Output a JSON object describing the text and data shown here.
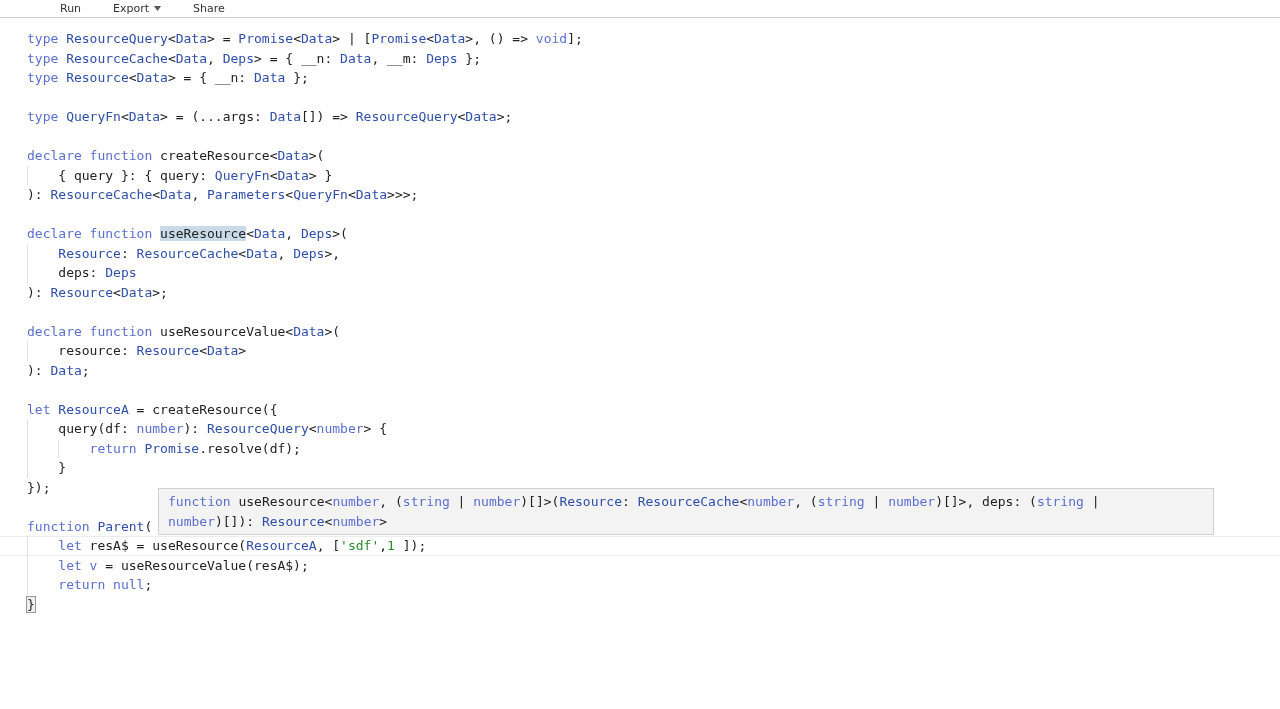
{
  "menu": [
    {
      "label": "Run",
      "dropdown": false
    },
    {
      "label": "Export",
      "dropdown": true
    },
    {
      "label": "Share",
      "dropdown": false
    }
  ],
  "editor": {
    "lines": [
      {
        "current": false,
        "tokens": [
          {
            "kind": "k",
            "text": "type"
          },
          {
            "kind": "t",
            "text": " ResourceQuery"
          },
          {
            "kind": "p",
            "text": "<"
          },
          {
            "kind": "t",
            "text": "Data"
          },
          {
            "kind": "p",
            "text": "> = "
          },
          {
            "kind": "t",
            "text": "Promise"
          },
          {
            "kind": "p",
            "text": "<"
          },
          {
            "kind": "t",
            "text": "Data"
          },
          {
            "kind": "p",
            "text": "> | ["
          },
          {
            "kind": "t",
            "text": "Promise"
          },
          {
            "kind": "p",
            "text": "<"
          },
          {
            "kind": "t",
            "text": "Data"
          },
          {
            "kind": "p",
            "text": ">, () => "
          },
          {
            "kind": "k",
            "text": "void"
          },
          {
            "kind": "p",
            "text": "];"
          }
        ]
      },
      {
        "current": false,
        "tokens": [
          {
            "kind": "k",
            "text": "type"
          },
          {
            "kind": "t",
            "text": " ResourceCache"
          },
          {
            "kind": "p",
            "text": "<"
          },
          {
            "kind": "t",
            "text": "Data"
          },
          {
            "kind": "p",
            "text": ", "
          },
          {
            "kind": "t",
            "text": "Deps"
          },
          {
            "kind": "p",
            "text": "> = { __n: "
          },
          {
            "kind": "t",
            "text": "Data"
          },
          {
            "kind": "p",
            "text": ", __m: "
          },
          {
            "kind": "t",
            "text": "Deps"
          },
          {
            "kind": "p",
            "text": " };"
          }
        ]
      },
      {
        "current": false,
        "tokens": [
          {
            "kind": "k",
            "text": "type"
          },
          {
            "kind": "t",
            "text": " Resource"
          },
          {
            "kind": "p",
            "text": "<"
          },
          {
            "kind": "t",
            "text": "Data"
          },
          {
            "kind": "p",
            "text": "> = { __n: "
          },
          {
            "kind": "t",
            "text": "Data"
          },
          {
            "kind": "p",
            "text": " };"
          }
        ]
      },
      {
        "current": false
      },
      {
        "current": false,
        "tokens": [
          {
            "kind": "k",
            "text": "type"
          },
          {
            "kind": "t",
            "text": " QueryFn"
          },
          {
            "kind": "p",
            "text": "<"
          },
          {
            "kind": "t",
            "text": "Data"
          },
          {
            "kind": "p",
            "text": "> = (...args: "
          },
          {
            "kind": "t",
            "text": "Data"
          },
          {
            "kind": "p",
            "text": "[]) => "
          },
          {
            "kind": "t",
            "text": "ResourceQuery"
          },
          {
            "kind": "p",
            "text": "<"
          },
          {
            "kind": "t",
            "text": "Data"
          },
          {
            "kind": "p",
            "text": ">;"
          }
        ]
      },
      {
        "current": false
      },
      {
        "current": false,
        "tokens": [
          {
            "kind": "k",
            "text": "declare function"
          },
          {
            "kind": "p",
            "text": " createResource<"
          },
          {
            "kind": "t",
            "text": "Data"
          },
          {
            "kind": "p",
            "text": ">("
          }
        ]
      },
      {
        "current": false,
        "tokens": [
          {
            "kind": "p",
            "text": "    { query }: { query: "
          },
          {
            "kind": "t",
            "text": "QueryFn"
          },
          {
            "kind": "p",
            "text": "<"
          },
          {
            "kind": "t",
            "text": "Data"
          },
          {
            "kind": "p",
            "text": "> }"
          }
        ]
      },
      {
        "current": false,
        "tokens": [
          {
            "kind": "p",
            "text": "): "
          },
          {
            "kind": "t",
            "text": "ResourceCache"
          },
          {
            "kind": "p",
            "text": "<"
          },
          {
            "kind": "t",
            "text": "Data"
          },
          {
            "kind": "p",
            "text": ", "
          },
          {
            "kind": "t",
            "text": "Parameters"
          },
          {
            "kind": "p",
            "text": "<"
          },
          {
            "kind": "t",
            "text": "QueryFn"
          },
          {
            "kind": "p",
            "text": "<"
          },
          {
            "kind": "t",
            "text": "Data"
          },
          {
            "kind": "p",
            "text": ">>>;"
          }
        ]
      },
      {
        "current": false
      },
      {
        "current": false,
        "tokens": [
          {
            "kind": "k",
            "text": "declare function "
          },
          {
            "kind": "sel",
            "text": "useResource"
          },
          {
            "kind": "p",
            "text": "<"
          },
          {
            "kind": "t",
            "text": "Data"
          },
          {
            "kind": "p",
            "text": ", "
          },
          {
            "kind": "t",
            "text": "Deps"
          },
          {
            "kind": "p",
            "text": ">("
          }
        ]
      },
      {
        "current": false,
        "tokens": [
          {
            "kind": "t",
            "text": "    Resource"
          },
          {
            "kind": "p",
            "text": ": "
          },
          {
            "kind": "t",
            "text": "ResourceCache"
          },
          {
            "kind": "p",
            "text": "<"
          },
          {
            "kind": "t",
            "text": "Data"
          },
          {
            "kind": "p",
            "text": ", "
          },
          {
            "kind": "t",
            "text": "Deps"
          },
          {
            "kind": "p",
            "text": ">,"
          }
        ]
      },
      {
        "current": false,
        "tokens": [
          {
            "kind": "p",
            "text": "    deps: "
          },
          {
            "kind": "t",
            "text": "Deps"
          }
        ]
      },
      {
        "current": false,
        "tokens": [
          {
            "kind": "p",
            "text": "): "
          },
          {
            "kind": "t",
            "text": "Resource"
          },
          {
            "kind": "p",
            "text": "<"
          },
          {
            "kind": "t",
            "text": "Data"
          },
          {
            "kind": "p",
            "text": ">;"
          }
        ]
      },
      {
        "current": false
      },
      {
        "current": false,
        "tokens": [
          {
            "kind": "k",
            "text": "declare function"
          },
          {
            "kind": "p",
            "text": " useResourceValue<"
          },
          {
            "kind": "t",
            "text": "Data"
          },
          {
            "kind": "p",
            "text": ">("
          }
        ]
      },
      {
        "current": false,
        "tokens": [
          {
            "kind": "p",
            "text": "    resource: "
          },
          {
            "kind": "t",
            "text": "Resource"
          },
          {
            "kind": "p",
            "text": "<"
          },
          {
            "kind": "t",
            "text": "Data"
          },
          {
            "kind": "p",
            "text": ">"
          }
        ]
      },
      {
        "current": false,
        "tokens": [
          {
            "kind": "p",
            "text": "): "
          },
          {
            "kind": "t",
            "text": "Data"
          },
          {
            "kind": "p",
            "text": ";"
          }
        ]
      },
      {
        "current": false
      },
      {
        "current": false,
        "tokens": [
          {
            "kind": "k",
            "text": "let"
          },
          {
            "kind": "t",
            "text": " ResourceA"
          },
          {
            "kind": "p",
            "text": " = createResource({"
          }
        ]
      },
      {
        "current": false,
        "tokens": [
          {
            "kind": "p",
            "text": "    query(df: "
          },
          {
            "kind": "k",
            "text": "number"
          },
          {
            "kind": "p",
            "text": "): "
          },
          {
            "kind": "t",
            "text": "ResourceQuery"
          },
          {
            "kind": "p",
            "text": "<"
          },
          {
            "kind": "k",
            "text": "number"
          },
          {
            "kind": "p",
            "text": "> {"
          }
        ]
      },
      {
        "current": false,
        "tokens": [
          {
            "kind": "k",
            "text": "        return"
          },
          {
            "kind": "t",
            "text": " Promise"
          },
          {
            "kind": "p",
            "text": ".resolve(df);"
          }
        ]
      },
      {
        "current": false,
        "tokens": [
          {
            "kind": "p",
            "text": "    }"
          }
        ]
      },
      {
        "current": false,
        "tokens": [
          {
            "kind": "p",
            "text": "});"
          }
        ]
      },
      {
        "current": false
      },
      {
        "current": false,
        "tokens": [
          {
            "kind": "k",
            "text": "function"
          },
          {
            "kind": "t",
            "text": " Parent"
          },
          {
            "kind": "p",
            "text": "("
          }
        ]
      },
      {
        "current": true,
        "tokens": [
          {
            "kind": "k",
            "text": "    let"
          },
          {
            "kind": "p",
            "text": " resA$ = useResource("
          },
          {
            "kind": "t",
            "text": "ResourceA"
          },
          {
            "kind": "p",
            "text": ", ["
          },
          {
            "kind": "s",
            "text": "'sdf'"
          },
          {
            "kind": "p",
            "text": ","
          },
          {
            "kind": "n",
            "text": "1"
          },
          {
            "kind": "p",
            "text": " ]);"
          }
        ]
      },
      {
        "current": false,
        "tokens": [
          {
            "kind": "k",
            "text": "    let v"
          },
          {
            "kind": "p",
            "text": " = useResourceValue(resA$);"
          }
        ]
      },
      {
        "current": false,
        "tokens": [
          {
            "kind": "k",
            "text": "    return null"
          },
          {
            "kind": "p",
            "text": ";"
          }
        ]
      },
      {
        "current": false,
        "tokens": [
          {
            "kind": "bm",
            "text": "}"
          }
        ]
      }
    ]
  },
  "tooltip": {
    "lines": [
      [
        {
          "kind": "k",
          "text": "function"
        },
        {
          "kind": "p",
          "text": " useResource<"
        },
        {
          "kind": "k",
          "text": "number"
        },
        {
          "kind": "p",
          "text": ", ("
        },
        {
          "kind": "k",
          "text": "string"
        },
        {
          "kind": "p",
          "text": " | "
        },
        {
          "kind": "k",
          "text": "number"
        },
        {
          "kind": "p",
          "text": ")[]>("
        },
        {
          "kind": "t",
          "text": "Resource"
        },
        {
          "kind": "p",
          "text": ": "
        },
        {
          "kind": "t",
          "text": "ResourceCache"
        },
        {
          "kind": "p",
          "text": "<"
        },
        {
          "kind": "k",
          "text": "number"
        },
        {
          "kind": "p",
          "text": ", ("
        },
        {
          "kind": "k",
          "text": "string"
        },
        {
          "kind": "p",
          "text": " | "
        },
        {
          "kind": "k",
          "text": "number"
        },
        {
          "kind": "p",
          "text": ")[]>, deps: ("
        },
        {
          "kind": "k",
          "text": "string"
        },
        {
          "kind": "p",
          "text": " |"
        }
      ],
      [
        {
          "kind": "k",
          "text": "number"
        },
        {
          "kind": "p",
          "text": ")[]): "
        },
        {
          "kind": "t",
          "text": "Resource"
        },
        {
          "kind": "p",
          "text": "<"
        },
        {
          "kind": "k",
          "text": "number"
        },
        {
          "kind": "p",
          "text": ">"
        }
      ]
    ]
  }
}
